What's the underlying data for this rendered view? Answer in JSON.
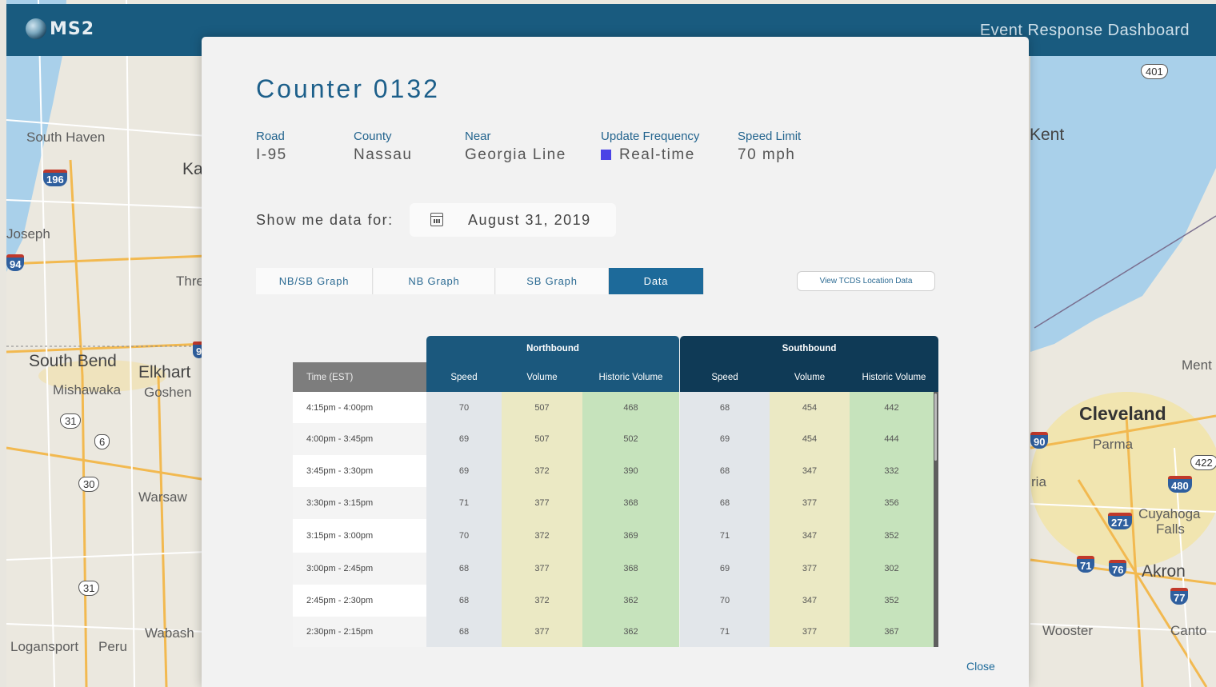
{
  "app": {
    "logo_text": "MS2",
    "dashboard_title": "Event Response Dashboard"
  },
  "map": {
    "labels": [
      "South Haven",
      "Ka",
      "Joseph",
      "Thre",
      "South Bend",
      "Elkhart",
      "Mishawaka",
      "Goshen",
      "Warsaw",
      "Wabash",
      "Logansport",
      "Peru",
      "Kent",
      "Cleveland",
      "Parma",
      "Cuyahoga",
      "Falls",
      "Akron",
      "Wooster",
      "Canto",
      "Ment",
      "ria"
    ],
    "shields": [
      "196",
      "94",
      "31",
      "6",
      "30",
      "31",
      "401",
      "90",
      "422",
      "480",
      "271",
      "71",
      "76",
      "77",
      "9"
    ]
  },
  "modal": {
    "title": "Counter 0132",
    "meta": [
      {
        "key": "Road",
        "value": "I-95"
      },
      {
        "key": "County",
        "value": "Nassau"
      },
      {
        "key": "Near",
        "value": "Georgia Line"
      },
      {
        "key": "Update Frequency",
        "value": "Real-time"
      },
      {
        "key": "Speed Limit",
        "value": "70 mph"
      }
    ],
    "frequency_color": "#4b43e6",
    "show_label": "Show me data for:",
    "date": "August 31, 2019",
    "tabs": [
      "NB/SB Graph",
      "NB Graph",
      "SB Graph",
      "Data"
    ],
    "active_tab": "Data",
    "tcds_button": "View TCDS Location Data",
    "close_label": "Close"
  },
  "table": {
    "time_header": "Time (EST)",
    "northbound_label": "Northbound",
    "southbound_label": "Southbound",
    "columns": [
      "Speed",
      "Volume",
      "Historic Volume",
      "Speed",
      "Volume",
      "Historic Volume"
    ],
    "rows": [
      {
        "time": "4:15pm - 4:00pm",
        "nb_speed": "70",
        "nb_volume": "507",
        "nb_hist": "468",
        "sb_speed": "68",
        "sb_volume": "454",
        "sb_hist": "442"
      },
      {
        "time": "4:00pm - 3:45pm",
        "nb_speed": "69",
        "nb_volume": "507",
        "nb_hist": "502",
        "sb_speed": "69",
        "sb_volume": "454",
        "sb_hist": "444"
      },
      {
        "time": "3:45pm - 3:30pm",
        "nb_speed": "69",
        "nb_volume": "372",
        "nb_hist": "390",
        "sb_speed": "68",
        "sb_volume": "347",
        "sb_hist": "332"
      },
      {
        "time": "3:30pm - 3:15pm",
        "nb_speed": "71",
        "nb_volume": "377",
        "nb_hist": "368",
        "sb_speed": "68",
        "sb_volume": "377",
        "sb_hist": "356"
      },
      {
        "time": "3:15pm - 3:00pm",
        "nb_speed": "70",
        "nb_volume": "372",
        "nb_hist": "369",
        "sb_speed": "71",
        "sb_volume": "347",
        "sb_hist": "352"
      },
      {
        "time": "3:00pm - 2:45pm",
        "nb_speed": "68",
        "nb_volume": "377",
        "nb_hist": "368",
        "sb_speed": "69",
        "sb_volume": "377",
        "sb_hist": "302"
      },
      {
        "time": "2:45pm - 2:30pm",
        "nb_speed": "68",
        "nb_volume": "372",
        "nb_hist": "362",
        "sb_speed": "70",
        "sb_volume": "347",
        "sb_hist": "352"
      },
      {
        "time": "2:30pm - 2:15pm",
        "nb_speed": "68",
        "nb_volume": "377",
        "nb_hist": "362",
        "sb_speed": "71",
        "sb_volume": "377",
        "sb_hist": "367"
      }
    ]
  },
  "colors": {
    "header_bar": "#195b7f",
    "northbound": "#1b587d",
    "southbound": "#0f3a56",
    "speed_cell": "#e2e6ea",
    "volume_cell": "#ebe9c4",
    "historic_cell": "#c6e3bc",
    "active_tab": "#1d6a9a"
  }
}
